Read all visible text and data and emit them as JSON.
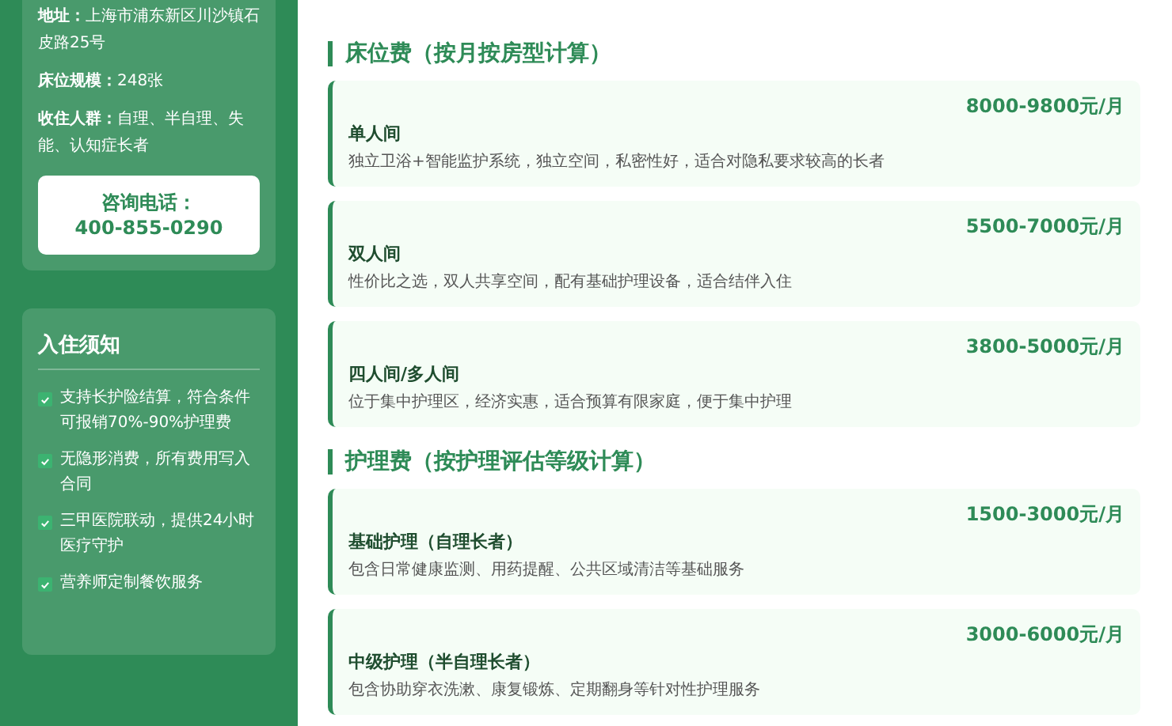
{
  "sidebar": {
    "info": [
      {
        "label": "地址：",
        "value": "上海市浦东新区川沙镇石皮路25号"
      },
      {
        "label": "床位规模：",
        "value": "248张"
      },
      {
        "label": "收住人群：",
        "value": "自理、半自理、失能、认知症长者"
      }
    ],
    "phone": {
      "label": "咨询电话：",
      "number": "400-855-0290"
    },
    "notice": {
      "title": "入住须知",
      "items": [
        {
          "text": "支持长护险结算，符合条件可报销70%-90%护理费",
          "checked": true
        },
        {
          "text": "无隐形消费，所有费用写入合同",
          "checked": true
        },
        {
          "text": "三甲医院联动，提供24小时医疗守护",
          "checked": true
        },
        {
          "text": "营养师定制餐饮服务",
          "checked": true
        }
      ]
    }
  },
  "sections": [
    {
      "title": "床位费（按月按房型计算）",
      "items": [
        {
          "name": "单人间",
          "price": "8000-9800元/月",
          "description": "独立卫浴+智能监护系统，独立空间，私密性好，适合对隐私要求较高的长者"
        },
        {
          "name": "双人间",
          "price": "5500-7000元/月",
          "description": "性价比之选，双人共享空间，配有基础护理设备，适合结伴入住"
        },
        {
          "name": "四人间/多人间",
          "price": "3800-5000元/月",
          "description": "位于集中护理区，经济实惠，适合预算有限家庭，便于集中护理"
        }
      ]
    },
    {
      "title": "护理费（按护理评估等级计算）",
      "items": [
        {
          "name": "基础护理（自理长者）",
          "price": "1500-3000元/月",
          "description": "包含日常健康监测、用药提醒、公共区域清洁等基础服务"
        },
        {
          "name": "中级护理（半自理长者）",
          "price": "3000-6000元/月",
          "description": "包含协助穿衣洗漱、康复锻炼、定期翻身等针对性护理服务"
        }
      ]
    }
  ]
}
